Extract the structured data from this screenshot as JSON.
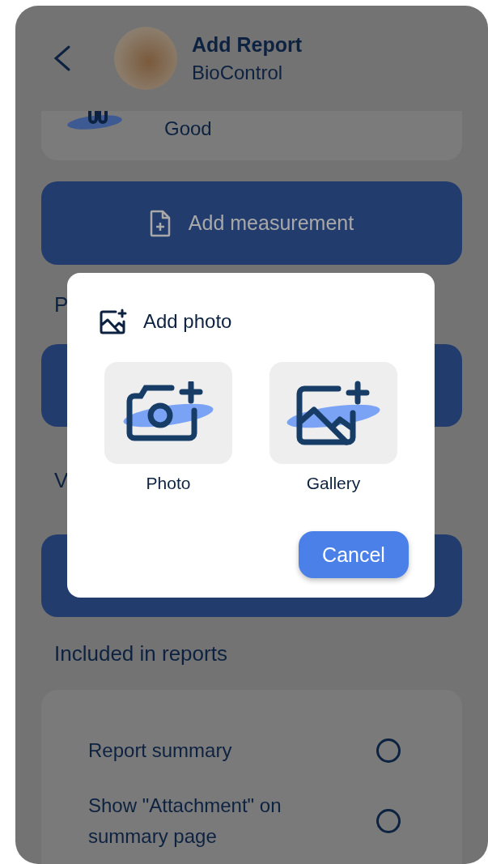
{
  "header": {
    "title": "Add Report",
    "subtitle": "BioControl"
  },
  "status_card": {
    "text": "Good"
  },
  "add_measurement_button": {
    "label": "Add measurement"
  },
  "sections": [
    {
      "heading": "P"
    },
    {
      "heading": "V"
    }
  ],
  "included": {
    "title": "Included in reports",
    "options": [
      {
        "label": "Report summary",
        "checked": false
      },
      {
        "label": "Show \"Attachment\" on summary page",
        "checked": false
      }
    ]
  },
  "dialog": {
    "title": "Add photo",
    "options": [
      {
        "kind": "camera",
        "label": "Photo"
      },
      {
        "kind": "gallery",
        "label": "Gallery"
      }
    ],
    "cancel": "Cancel"
  }
}
